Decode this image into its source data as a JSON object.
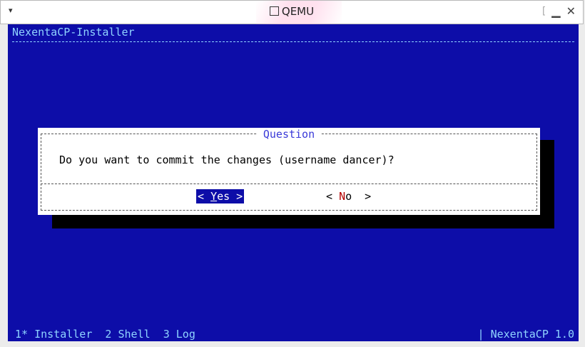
{
  "window": {
    "menu_glyph": "▾",
    "title": "QEMU",
    "min_glyph": "▁",
    "restore_glyph": "[",
    "close_glyph": "✕"
  },
  "screen": {
    "app_title": "NexentaCP-Installer"
  },
  "dialog": {
    "title": "Question",
    "message": "Do you want to commit the changes (username dancer)?",
    "yes": {
      "open": "< ",
      "hotkey": "Y",
      "rest": "es",
      "close": " >"
    },
    "no": {
      "open": "< ",
      "hotkey": "N",
      "rest": "o",
      "close": "  >"
    }
  },
  "statusbar": {
    "left": "1* Installer  2 Shell  3 Log",
    "right": "| NexentaCP 1.0"
  },
  "colors": {
    "background": "#0d0da8",
    "accent_text": "#8fd3ff",
    "dialog_bg": "#ffffff",
    "hotkey": "#b40000"
  }
}
